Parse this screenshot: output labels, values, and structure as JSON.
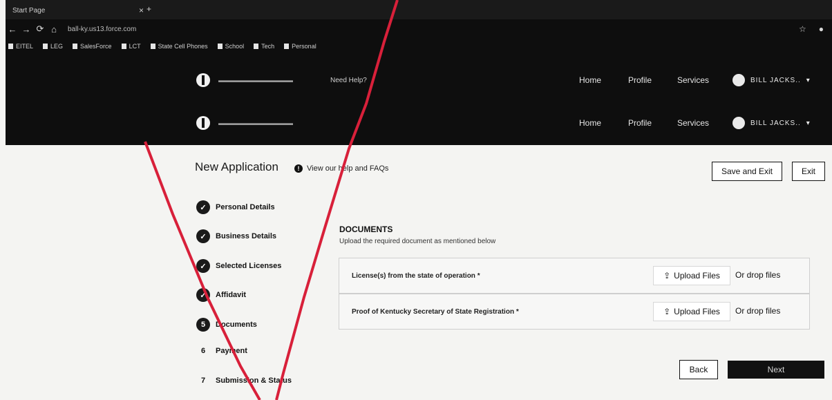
{
  "browser": {
    "tab_title": "Start Page",
    "tab_close": "×",
    "tab_add": "+",
    "url": "ball-ky.us13.force.com",
    "bookmarks": [
      "EITEL",
      "LEG",
      "SalesForce",
      "LCT",
      "State Cell Phones",
      "School",
      "Tech",
      "Personal"
    ]
  },
  "site_header": {
    "help": "Need Help?",
    "nav": [
      "Home",
      "Profile",
      "Services"
    ],
    "user": "BILL JACKS..",
    "user_caret": "▾"
  },
  "page": {
    "title": "New Application",
    "help_link": "View our help and FAQs",
    "save_exit": "Save and Exit",
    "exit": "Exit"
  },
  "steps": [
    {
      "label": "Personal Details",
      "marker": "✓"
    },
    {
      "label": "Business Details",
      "marker": "✓"
    },
    {
      "label": "Selected Licenses",
      "marker": "✓"
    },
    {
      "label": "Affidavit",
      "marker": "✓"
    },
    {
      "label": "Documents",
      "marker": "5"
    },
    {
      "label": "Payment",
      "marker": "6"
    },
    {
      "label": "Submission & Status",
      "marker": "7"
    }
  ],
  "documents": {
    "title": "DOCUMENTS",
    "subtitle": "Upload the required document as mentioned below",
    "items": [
      {
        "label": "License(s) from the state of operation *",
        "upload": "Upload Files",
        "drop": "Or drop files"
      },
      {
        "label": "Proof of Kentucky Secretary of State Registration *",
        "upload": "Upload Files",
        "drop": "Or drop files"
      }
    ]
  },
  "footer_buttons": {
    "back": "Back",
    "next": "Next"
  },
  "colors": {
    "header_bg": "#0e0e0e",
    "annotation_red": "#d8203a"
  }
}
